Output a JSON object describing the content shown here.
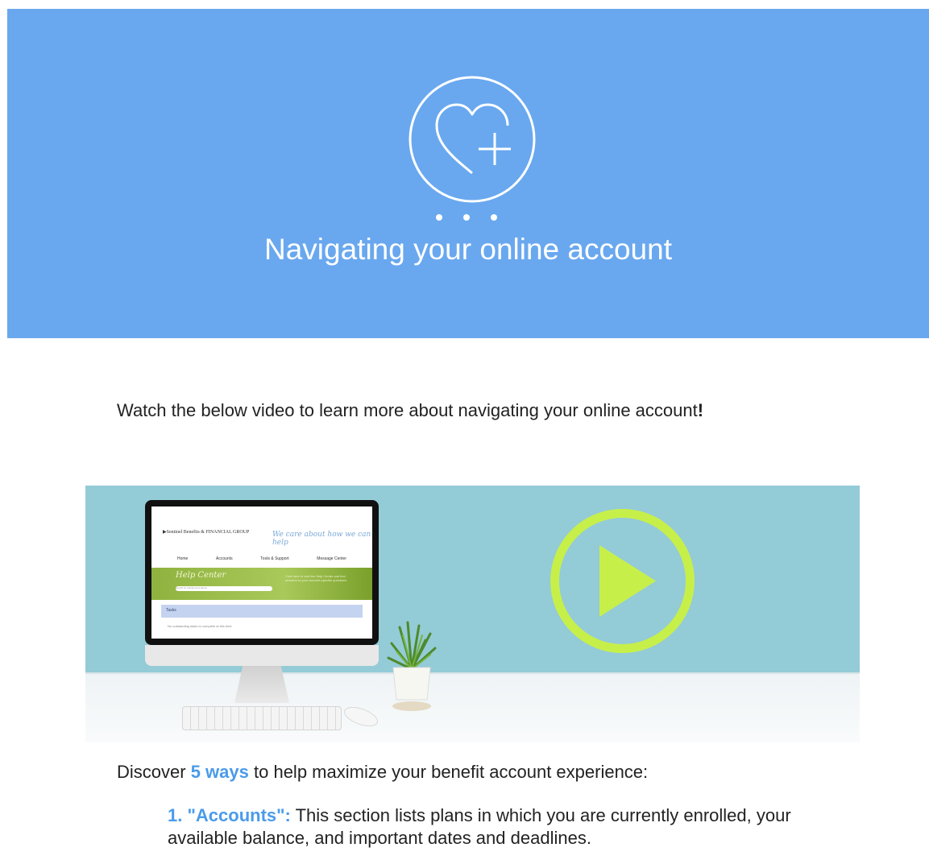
{
  "header": {
    "title": "Navigating your online account",
    "background_color": "#69a8ef",
    "icon": "heart-plus-icon"
  },
  "intro": {
    "text": "Watch the below video to learn more about navigating your online account",
    "exclaim": "!"
  },
  "video": {
    "play_icon": "play-icon",
    "accent_color": "#c7ef4a",
    "screen": {
      "logo": "▶Sentinel Benefits & FINANCIAL GROUP",
      "tagline": "We care about how we can help",
      "nav": [
        "Home",
        "Accounts",
        "Tools & Support",
        "Message Center"
      ],
      "hero_title": "Help Center",
      "hero_placeholder": "search for articles and videos",
      "hero_text": "Click here to visit the Help Center and find answers to your account-specific questions",
      "bar_label": "Tasks",
      "note": "No outstanding tasks to complete at this time"
    }
  },
  "discover": {
    "before": "Discover",
    "highlight": "5 ways",
    "after": "to help maximize your benefit account experience:"
  },
  "items": [
    {
      "heading": "1. \"Accounts\":",
      "text": "This section lists plans in which you are currently enrolled, your available balance, and important dates and deadlines."
    }
  ]
}
